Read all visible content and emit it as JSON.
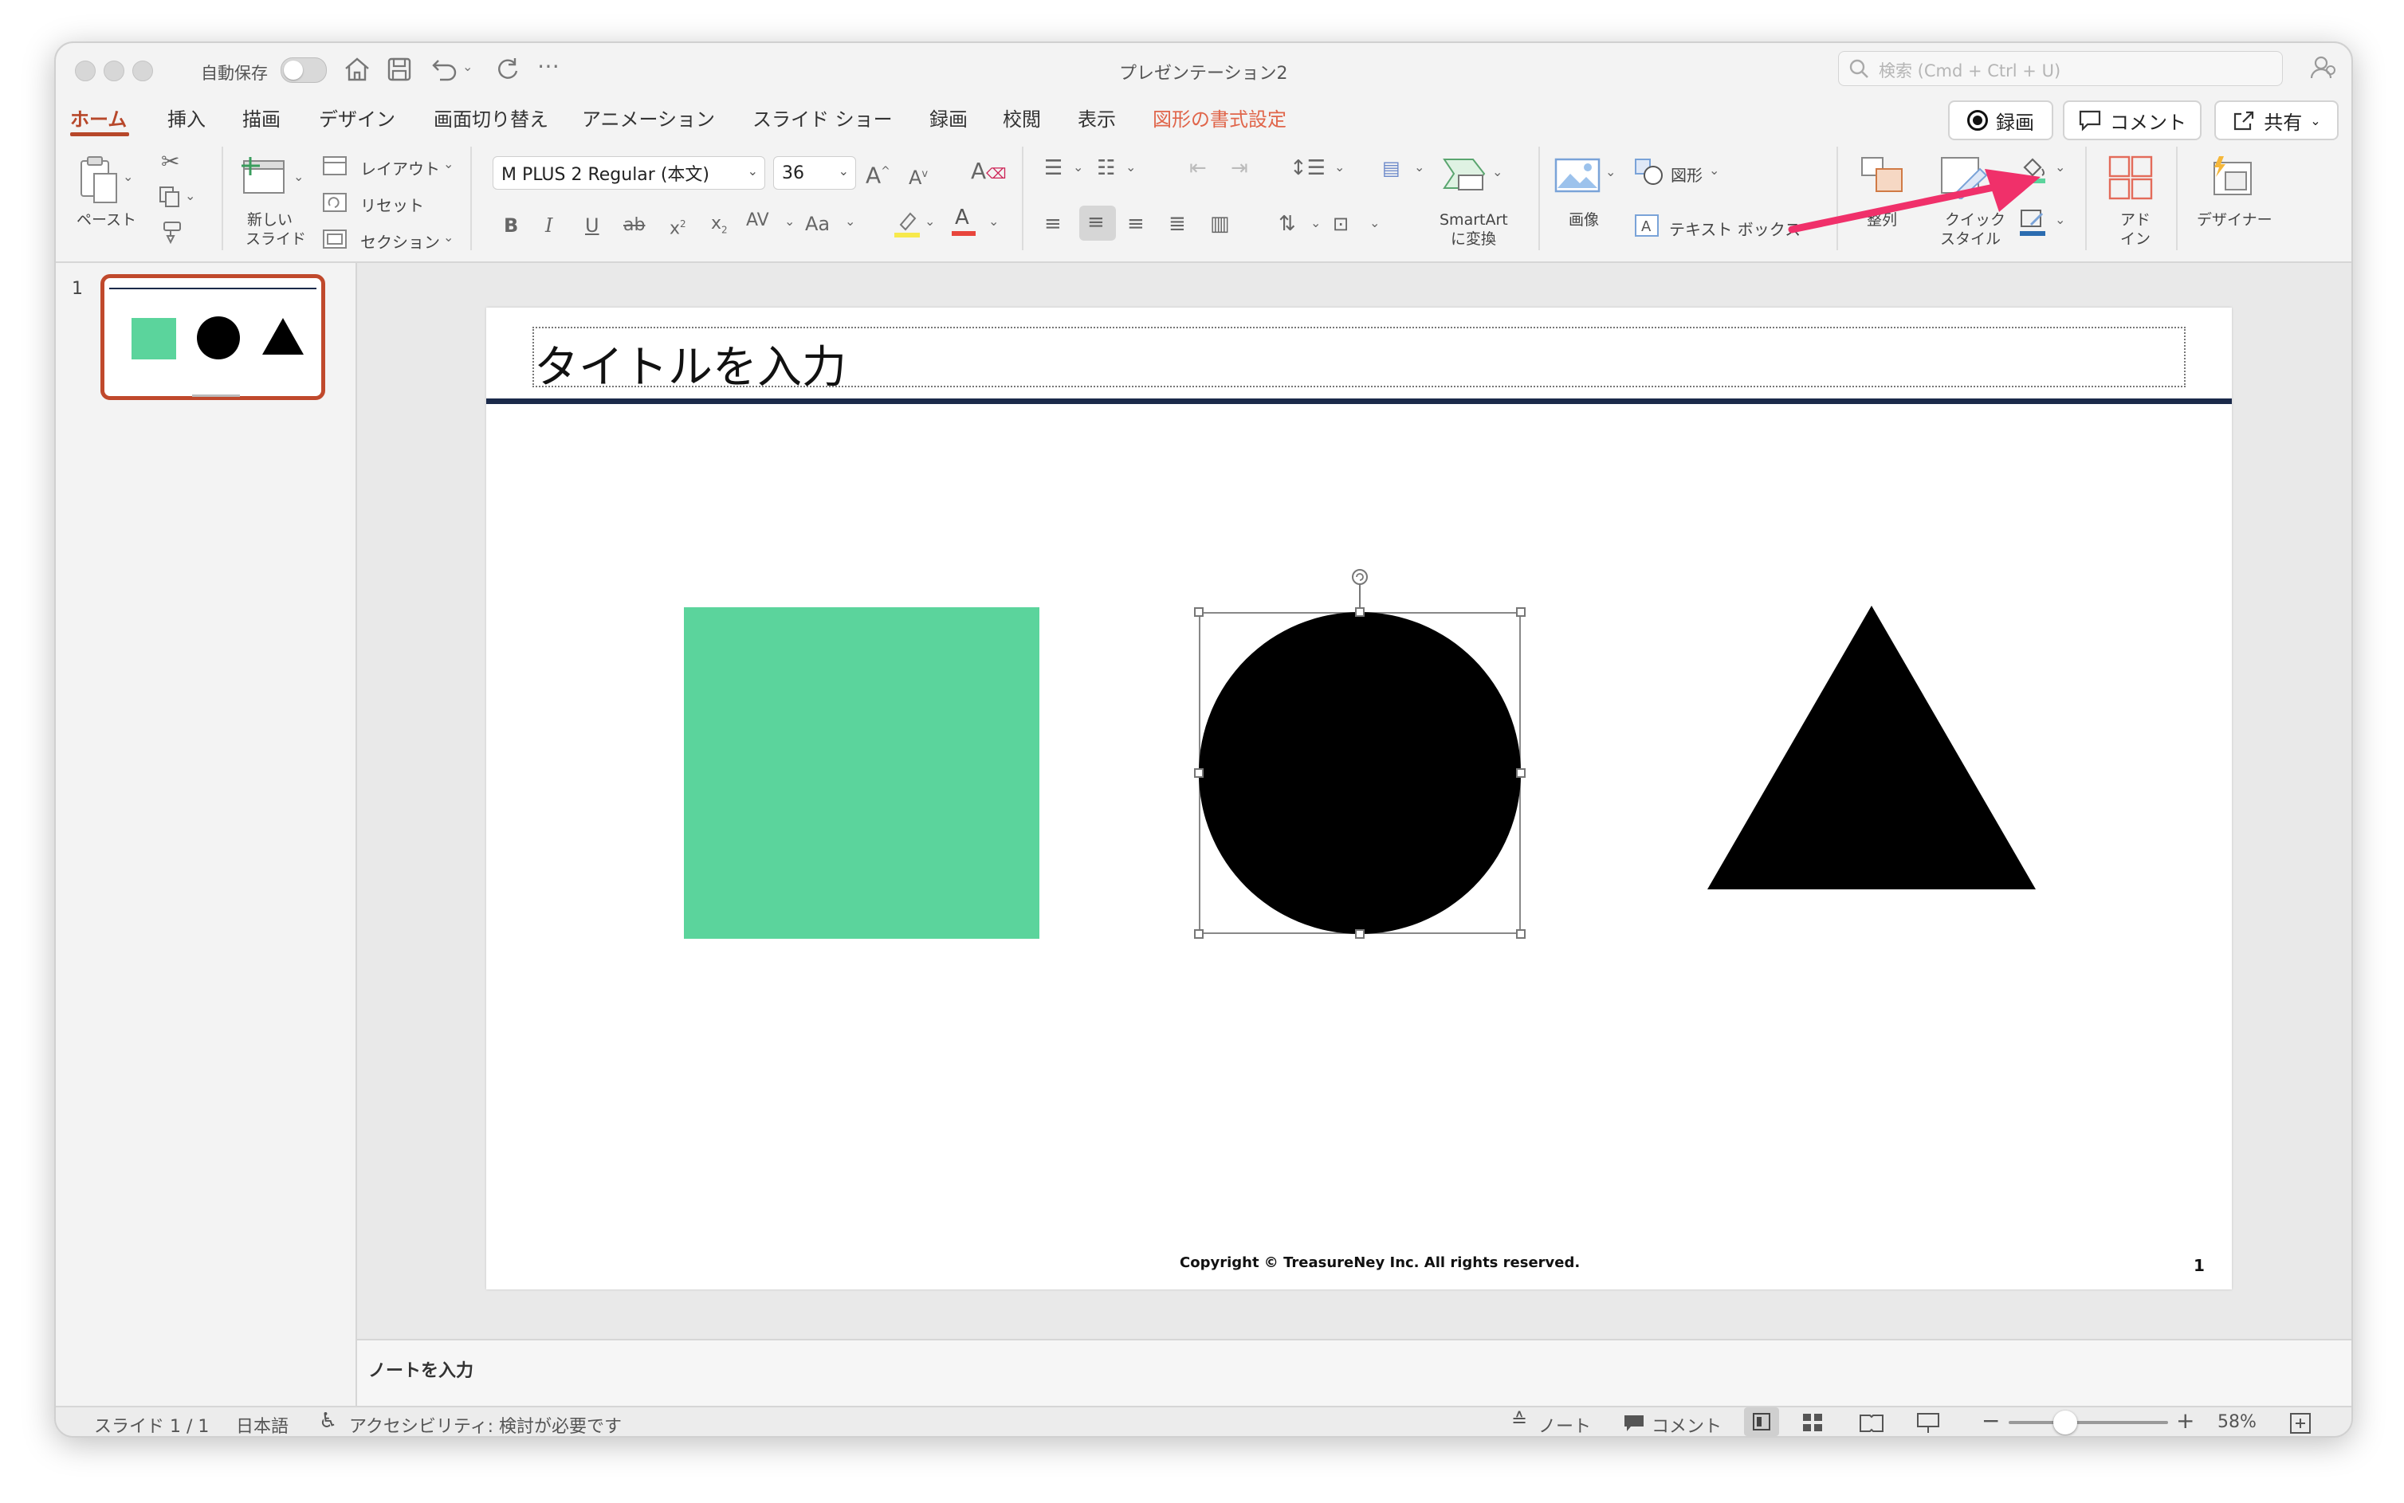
{
  "window": {
    "title": "プレゼンテーション2",
    "autosave_label": "自動保存",
    "search_placeholder": "検索 (Cmd + Ctrl + U)"
  },
  "tabs": [
    {
      "label": "ホーム",
      "active": true
    },
    {
      "label": "挿入"
    },
    {
      "label": "描画"
    },
    {
      "label": "デザイン"
    },
    {
      "label": "画面切り替え"
    },
    {
      "label": "アニメーション"
    },
    {
      "label": "スライド ショー"
    },
    {
      "label": "録画"
    },
    {
      "label": "校閲"
    },
    {
      "label": "表示"
    },
    {
      "label": "図形の書式設定",
      "contextual": true
    }
  ],
  "header_buttons": {
    "record": "録画",
    "comment": "コメント",
    "share": "共有"
  },
  "ribbon": {
    "paste": "ペースト",
    "new_slide_line1": "新しい",
    "new_slide_line2": "スライド",
    "layout": "レイアウト",
    "reset": "リセット",
    "section": "セクション",
    "font_name": "M PLUS 2 Regular (本文)",
    "font_size": "36",
    "smartart_line1": "SmartArt",
    "smartart_line2": "に変換",
    "image": "画像",
    "shapes": "図形",
    "textbox": "テキスト ボックス",
    "arrange": "整列",
    "quick_style_line1": "クイック",
    "quick_style_line2": "スタイル",
    "addin_line1": "アド",
    "addin_line2": "イン",
    "designer": "デザイナー"
  },
  "thumbnail": {
    "number": "1"
  },
  "slide": {
    "title_placeholder": "タイトルを入力",
    "footer": "Copyright © TreasureNey Inc. All rights reserved.",
    "page_number": "1",
    "square_color": "#5bd49c",
    "circle_color": "#000000",
    "triangle_color": "#000000",
    "rule_color": "#1b2a4a"
  },
  "notes_placeholder": "ノートを入力",
  "status_bar": {
    "slide_indicator": "スライド 1 / 1",
    "language": "日本語",
    "accessibility": "アクセシビリティ: 検討が必要です",
    "notes": "ノート",
    "comments": "コメント",
    "zoom": "58%"
  },
  "annotation": {
    "arrow_color": "#f0306a"
  }
}
